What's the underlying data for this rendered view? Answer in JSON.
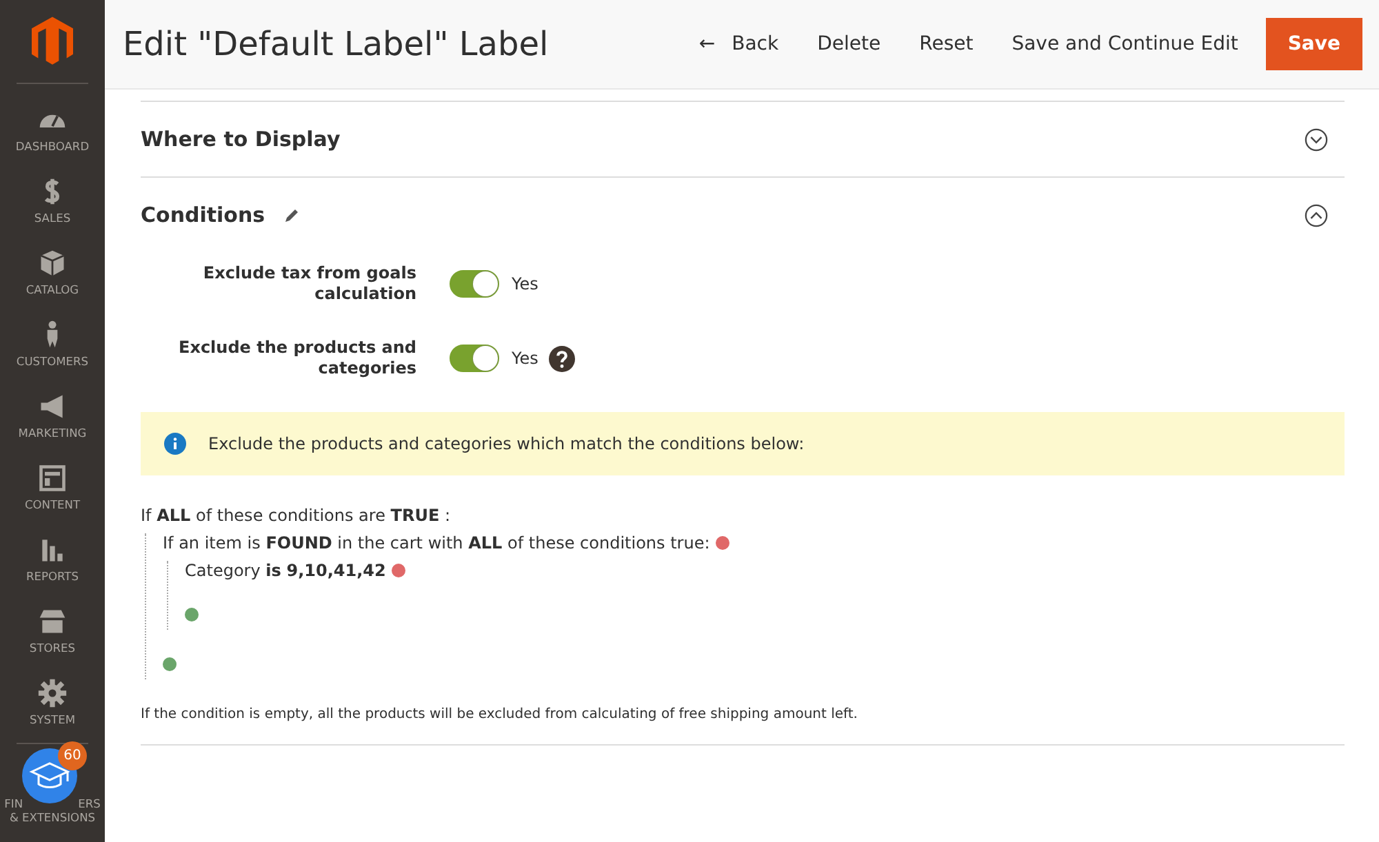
{
  "sidebar": {
    "items": [
      {
        "kind": "dashboard",
        "label": "DASHBOARD"
      },
      {
        "kind": "sales",
        "label": "SALES"
      },
      {
        "kind": "catalog",
        "label": "CATALOG"
      },
      {
        "kind": "customers",
        "label": "CUSTOMERS"
      },
      {
        "kind": "marketing",
        "label": "MARKETING"
      },
      {
        "kind": "content",
        "label": "CONTENT"
      },
      {
        "kind": "reports",
        "label": "REPORTS"
      },
      {
        "kind": "stores",
        "label": "STORES"
      },
      {
        "kind": "system",
        "label": "SYSTEM"
      }
    ],
    "partners": {
      "label_parts": [
        "FIN",
        "ERS"
      ],
      "label_line2": "& EXTENSIONS",
      "badge": "60"
    }
  },
  "header": {
    "title": "Edit \"Default Label\" Label",
    "back_icon": "←",
    "back": "Back",
    "actions": [
      "Delete",
      "Reset",
      "Save and Continue Edit"
    ],
    "primary": "Save"
  },
  "sections": [
    {
      "title": "Where to Display",
      "expanded": false,
      "editable": false
    },
    {
      "title": "Conditions",
      "expanded": true,
      "editable": true
    }
  ],
  "fields": [
    {
      "label": "Exclude tax from goals calculation",
      "on": true,
      "value": "Yes",
      "help": false
    },
    {
      "label": "Exclude the products and categories",
      "on": true,
      "value": "Yes",
      "help": true
    }
  ],
  "notice": "Exclude the products and categories which match the conditions below:",
  "rule": {
    "text": "If **ALL**  of these conditions are **TRUE** :",
    "children": [
      {
        "text": "If an item is **FOUND**  in the cart with **ALL**  of these conditions true:",
        "children": [
          {
            "text": "Category  **is**  **9,10,41,42**"
          }
        ]
      }
    ]
  },
  "footnote": "If the condition is empty, all the products will be excluded from calculating of free shipping amount left."
}
